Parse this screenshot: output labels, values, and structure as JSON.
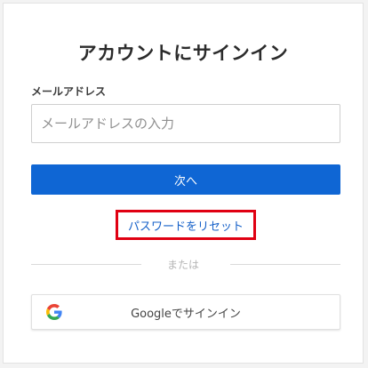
{
  "signin": {
    "title": "アカウントにサインイン",
    "email_label": "メールアドレス",
    "email_placeholder": "メールアドレスの入力",
    "email_value": "",
    "next_button": "次へ",
    "reset_link": "パスワードをリセット",
    "divider_text": "または",
    "google_button": "Googleでサインイン"
  },
  "colors": {
    "primary_button": "#0f66d4",
    "link": "#1560c8",
    "highlight_border": "#e00012"
  },
  "icons": {
    "google": "google-g-icon"
  }
}
